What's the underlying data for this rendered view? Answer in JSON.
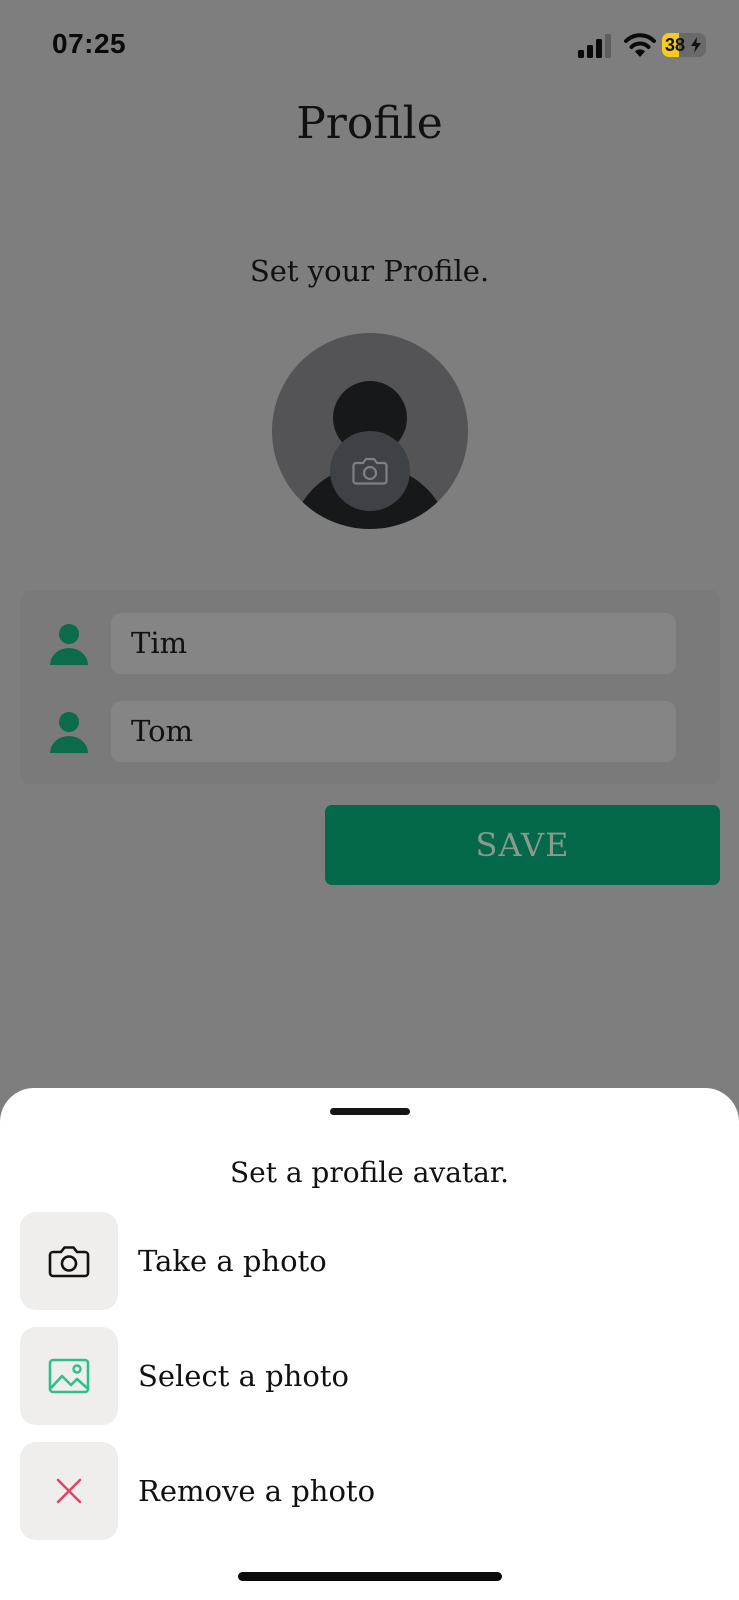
{
  "status_bar": {
    "time": "07:25",
    "battery_level": "38",
    "battery_fraction": 0.38,
    "battery_charging": true,
    "signal_bars": 4,
    "signal_active_bars": 3
  },
  "page": {
    "title": "Profile",
    "subtitle": "Set your Profile."
  },
  "avatar": {
    "placeholder_icon": "person-silhouette",
    "camera_icon": "camera-icon"
  },
  "form": {
    "first_name_value": "Tim",
    "last_name_value": "Tom",
    "field_icon": "person-icon",
    "save_label": "SAVE"
  },
  "sheet": {
    "title": "Set a profile avatar.",
    "options": [
      {
        "label": "Take a photo",
        "icon": "camera-icon",
        "icon_color": "#111111"
      },
      {
        "label": "Select a photo",
        "icon": "image-icon",
        "icon_color": "#2fbf8c"
      },
      {
        "label": "Remove a photo",
        "icon": "close-icon",
        "icon_color": "#e0446a"
      }
    ]
  },
  "colors": {
    "overlay_background": "#7e7e7e",
    "accent_green": "#03694a",
    "field_icon_green": "#0b6b4a",
    "battery_yellow": "#f5cb1e"
  }
}
